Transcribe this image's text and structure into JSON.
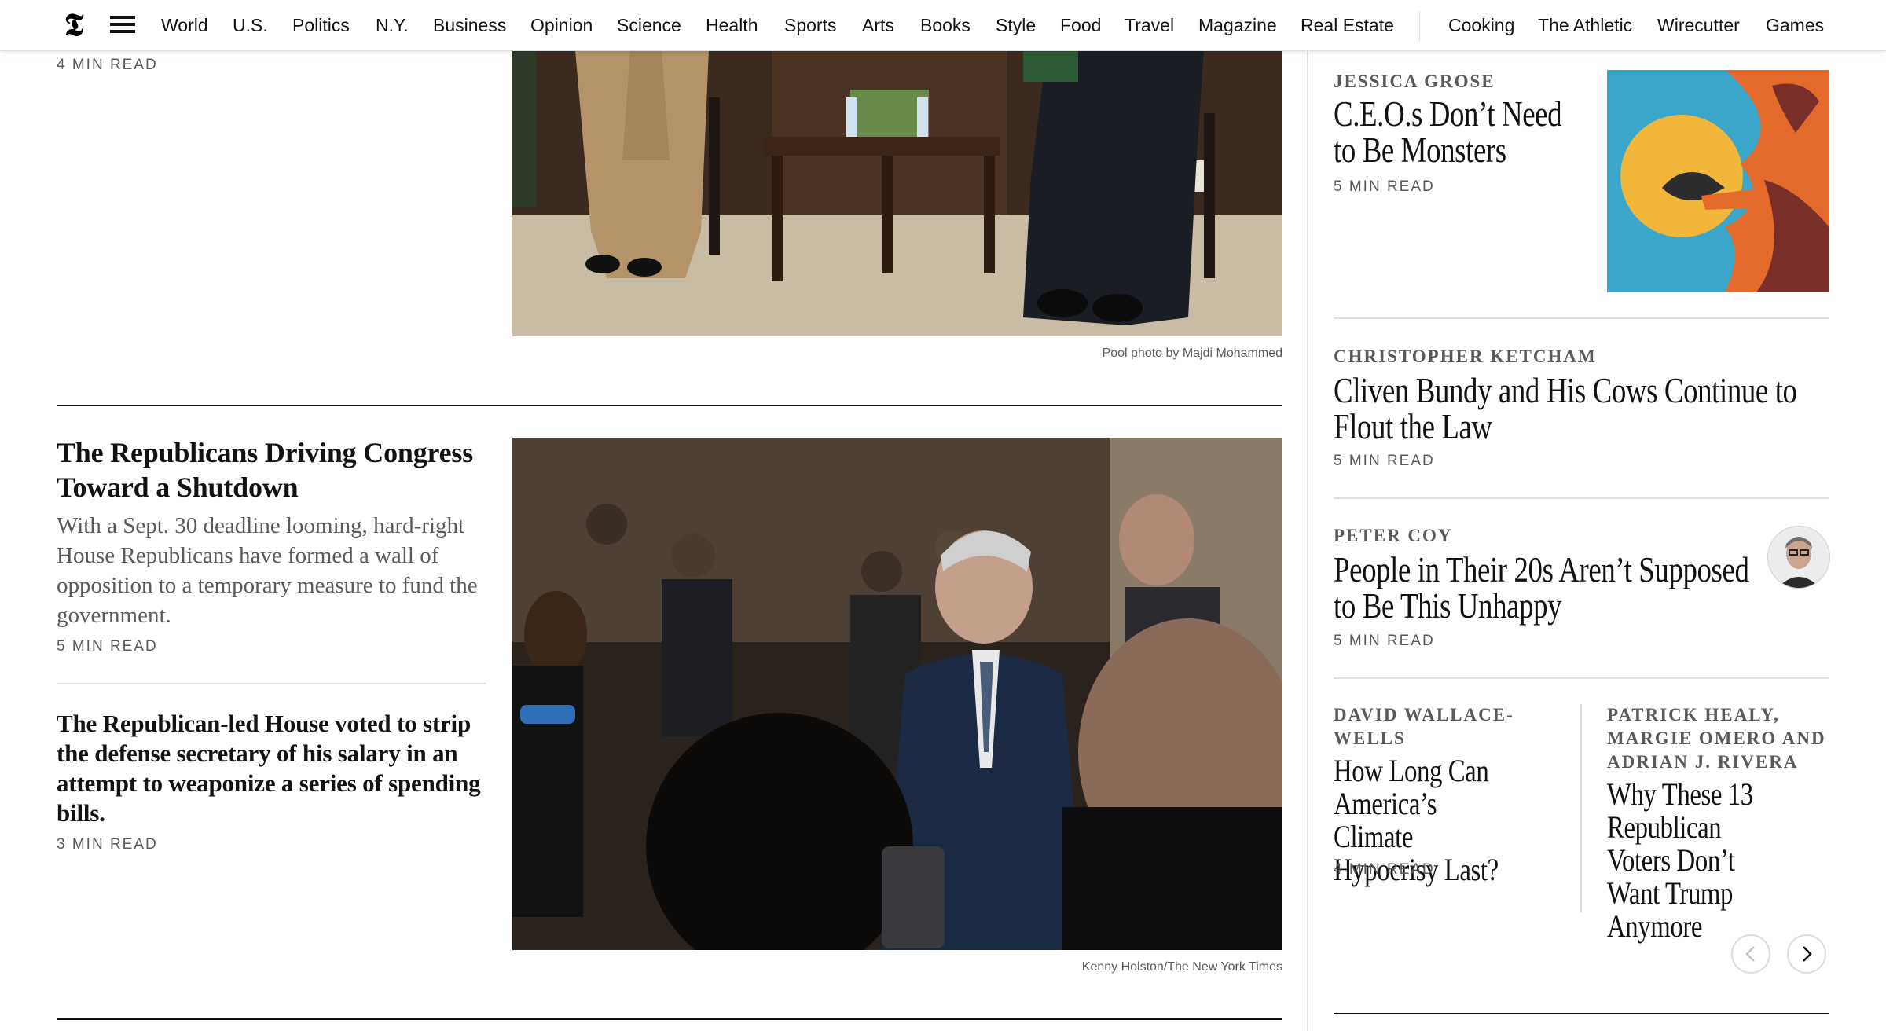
{
  "nav": {
    "sections": [
      "World",
      "U.S.",
      "Politics",
      "N.Y.",
      "Business",
      "Opinion",
      "Science",
      "Health",
      "Sports",
      "Arts",
      "Books",
      "Style",
      "Food",
      "Travel",
      "Magazine",
      "Real Estate"
    ],
    "products": [
      "Cooking",
      "The Athletic",
      "Wirecutter",
      "Games"
    ]
  },
  "top_story": {
    "read_time": "4 MIN READ",
    "photo_credit": "Pool photo by Majdi Mohammed"
  },
  "lead_story": {
    "headline": "The Republicans Driving Congress Toward a Shutdown",
    "summary": "With a Sept. 30 deadline looming, hard-right House Republicans have formed a wall of opposition to a temporary measure to fund the government.",
    "read_time": "5 MIN READ",
    "photo_credit": "Kenny Holston/The New York Times"
  },
  "secondary_story": {
    "headline": "The Republican-led House voted to strip the defense secretary of his salary in an attempt to weaponize a series of spending bills.",
    "read_time": "3 MIN READ"
  },
  "opinion": [
    {
      "byline": "Jessica Grose",
      "headline": "C.E.O.s Don’t Need to Be Monsters",
      "read_time": "5 MIN READ",
      "image": "bird-on-hand-illustration"
    },
    {
      "byline": "Christopher Ketcham",
      "headline": "Cliven Bundy and His Cows Continue to Flout the Law",
      "read_time": "5 MIN READ"
    },
    {
      "byline": "Peter Coy",
      "headline": "People in Their 20s Aren’t Supposed to Be This Unhappy",
      "read_time": "5 MIN READ",
      "image": "author-headshot"
    },
    {
      "byline": "David Wallace-Wells",
      "headline": "How Long Can America’s Climate Hypocrisy Last?",
      "read_time": "4 MIN READ"
    },
    {
      "byline": "Patrick Healy, Margie Omero and Adrian J. Rivera",
      "headline": "Why These 13 Republican Voters Don’t Want Trump Anymore"
    }
  ],
  "icons": {
    "logo": "nyt-logo-icon",
    "menu": "hamburger-menu-icon",
    "prev": "chevron-left-icon",
    "next": "chevron-right-icon"
  },
  "logo_glyph": "𝕿",
  "colors": {
    "text": "#121212",
    "secondary_text": "#5a5a5a",
    "rule": "#dfdfdf"
  }
}
